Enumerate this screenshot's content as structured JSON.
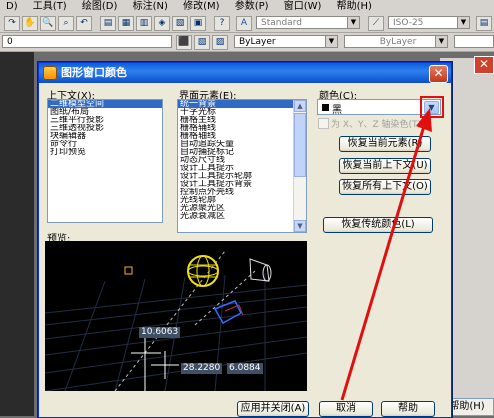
{
  "menubar": {
    "items": [
      "D)",
      "工具(T)",
      "绘图(D)",
      "标注(N)",
      "修改(M)",
      "参数(P)",
      "窗口(W)",
      "帮助(H)"
    ]
  },
  "toolbar": {
    "text_style": "Standard",
    "dim_style": "ISO-25",
    "layer_value": "0",
    "color_value": "ByLayer",
    "linetype_value": "ByLayer"
  },
  "dialog": {
    "title": "图形窗口颜色",
    "context_label": "上下文(X):",
    "context_items": [
      "二维模型空间",
      "图纸/布局",
      "三维平行投影",
      "三维透视投影",
      "块编辑器",
      "命令行",
      "打印预览"
    ],
    "context_selected": 0,
    "element_label": "界面元素(E):",
    "element_items": [
      "统一背景",
      "十字光标",
      "栅格主线",
      "栅格辅线",
      "栅格轴线",
      "自动追踪矢量",
      "自动捕捉标记",
      "动态尺寸线",
      "设计工具提示",
      "设计工具提示轮廓",
      "设计工具提示背景",
      "控制点外壳线",
      "光线轮廓",
      "光源聚光区",
      "光源衰减区"
    ],
    "element_selected": 0,
    "color_label": "颜色(C):",
    "color_value": "黑",
    "tint_checkbox_label": "为 X、Y、Z 轴染色(T)",
    "buttons": {
      "restore_current_element": "恢复当前元素(R)",
      "restore_current_context": "恢复当前上下文(U)",
      "restore_all_contexts": "恢复所有上下文(O)",
      "restore_classic_colors": "恢复传统颜色(L)",
      "apply_close": "应用并关闭(A)",
      "cancel": "取消",
      "help": "帮助"
    },
    "preview_label": "预览:",
    "preview_coords": {
      "first": "10.6063",
      "second_a": "28.2280",
      "second_b": "6.0884"
    }
  },
  "background": {
    "help_button_label": "帮助(H)"
  },
  "colors": {
    "title_blue": "#0a5fd6",
    "annotation_red": "#e01010",
    "preview_black": "#000000"
  }
}
